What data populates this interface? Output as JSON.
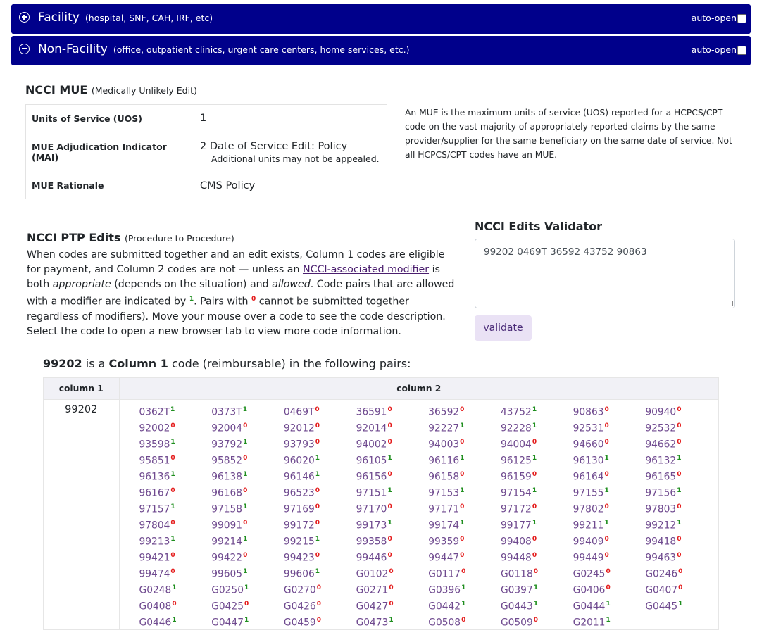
{
  "sections": [
    {
      "label": "Facility",
      "sub": "(hospital, SNF, CAH, IRF, etc)",
      "state": "collapsed",
      "auto": "auto-open"
    },
    {
      "label": "Non-Facility",
      "sub": "(office, outpatient clinics, urgent care centers, home services, etc.)",
      "state": "expanded",
      "auto": "auto-open"
    }
  ],
  "mue": {
    "title": "NCCI MUE",
    "subtitle": "(Medically Unlikely Edit)",
    "rows": [
      {
        "k": "Units of Service (UOS)",
        "v": "1"
      },
      {
        "k": "MUE Adjudication Indicator (MAI)",
        "v": "2 Date of Service Edit: Policy",
        "note": "Additional units may not be appealed."
      },
      {
        "k": "MUE Rationale",
        "v": "CMS Policy"
      }
    ],
    "desc": "An MUE is the maximum units of service (UOS) reported for a HCPCS/CPT code on the vast majority of appropriately reported claims by the same provider/supplier for the same beneficiary on the same date of service. Not all HCPCS/CPT codes have an MUE."
  },
  "ptp": {
    "title": "NCCI PTP Edits",
    "subtitle": "(Procedure to Procedure)",
    "t1": "When codes are submitted together and an edit exists, Column 1 codes are eligible for payment, and Column 2 codes are not — unless an ",
    "link": "NCCI-associated modifier",
    "t2": " is both ",
    "em1": "appropriate",
    "t3": " (depends on the situation) and ",
    "em2": "allowed",
    "t4": ". Code pairs that are allowed with a modifier are indicated by ",
    "s1": "1",
    "t5": ". Pairs with ",
    "s0": "0",
    "t6": " cannot be submitted together regardless of modifiers). Move your mouse over a code to see the code description. Select the code to open a new browser tab to view more code information."
  },
  "validator": {
    "title": "NCCI Edits Validator",
    "value": "99202 0469T 36592 43752 90863",
    "button": "validate"
  },
  "pairs": {
    "code": "99202",
    "mid": " is a ",
    "col": "Column 1",
    "tail": " code (reimbursable) in the following pairs:",
    "col1_header": "column 1",
    "col2_header": "column 2",
    "col1_value": "99202",
    "codes": [
      [
        "0362T",
        "1"
      ],
      [
        "0373T",
        "1"
      ],
      [
        "0469T",
        "0"
      ],
      [
        "36591",
        "0"
      ],
      [
        "36592",
        "0"
      ],
      [
        "43752",
        "1"
      ],
      [
        "90863",
        "0"
      ],
      [
        "90940",
        "0"
      ],
      [
        "92002",
        "0"
      ],
      [
        "92004",
        "0"
      ],
      [
        "92012",
        "0"
      ],
      [
        "92014",
        "0"
      ],
      [
        "92227",
        "1"
      ],
      [
        "92228",
        "1"
      ],
      [
        "92531",
        "0"
      ],
      [
        "92532",
        "0"
      ],
      [
        "93598",
        "1"
      ],
      [
        "93792",
        "1"
      ],
      [
        "93793",
        "0"
      ],
      [
        "94002",
        "0"
      ],
      [
        "94003",
        "0"
      ],
      [
        "94004",
        "0"
      ],
      [
        "94660",
        "0"
      ],
      [
        "94662",
        "0"
      ],
      [
        "95851",
        "0"
      ],
      [
        "95852",
        "0"
      ],
      [
        "96020",
        "1"
      ],
      [
        "96105",
        "1"
      ],
      [
        "96116",
        "1"
      ],
      [
        "96125",
        "1"
      ],
      [
        "96130",
        "1"
      ],
      [
        "96132",
        "1"
      ],
      [
        "96136",
        "1"
      ],
      [
        "96138",
        "1"
      ],
      [
        "96146",
        "1"
      ],
      [
        "96156",
        "0"
      ],
      [
        "96158",
        "0"
      ],
      [
        "96159",
        "0"
      ],
      [
        "96164",
        "0"
      ],
      [
        "96165",
        "0"
      ],
      [
        "96167",
        "0"
      ],
      [
        "96168",
        "0"
      ],
      [
        "96523",
        "0"
      ],
      [
        "97151",
        "1"
      ],
      [
        "97153",
        "1"
      ],
      [
        "97154",
        "1"
      ],
      [
        "97155",
        "1"
      ],
      [
        "97156",
        "1"
      ],
      [
        "97157",
        "1"
      ],
      [
        "97158",
        "1"
      ],
      [
        "97169",
        "0"
      ],
      [
        "97170",
        "0"
      ],
      [
        "97171",
        "0"
      ],
      [
        "97172",
        "0"
      ],
      [
        "97802",
        "0"
      ],
      [
        "97803",
        "0"
      ],
      [
        "97804",
        "0"
      ],
      [
        "99091",
        "0"
      ],
      [
        "99172",
        "0"
      ],
      [
        "99173",
        "1"
      ],
      [
        "99174",
        "1"
      ],
      [
        "99177",
        "1"
      ],
      [
        "99211",
        "1"
      ],
      [
        "99212",
        "1"
      ],
      [
        "99213",
        "1"
      ],
      [
        "99214",
        "1"
      ],
      [
        "99215",
        "1"
      ],
      [
        "99358",
        "0"
      ],
      [
        "99359",
        "0"
      ],
      [
        "99408",
        "0"
      ],
      [
        "99409",
        "0"
      ],
      [
        "99418",
        "0"
      ],
      [
        "99421",
        "0"
      ],
      [
        "99422",
        "0"
      ],
      [
        "99423",
        "0"
      ],
      [
        "99446",
        "0"
      ],
      [
        "99447",
        "0"
      ],
      [
        "99448",
        "0"
      ],
      [
        "99449",
        "0"
      ],
      [
        "99463",
        "0"
      ],
      [
        "99474",
        "0"
      ],
      [
        "99605",
        "1"
      ],
      [
        "99606",
        "1"
      ],
      [
        "G0102",
        "0"
      ],
      [
        "G0117",
        "0"
      ],
      [
        "G0118",
        "0"
      ],
      [
        "G0245",
        "0"
      ],
      [
        "G0246",
        "0"
      ],
      [
        "G0248",
        "1"
      ],
      [
        "G0250",
        "1"
      ],
      [
        "G0270",
        "0"
      ],
      [
        "G0271",
        "0"
      ],
      [
        "G0396",
        "1"
      ],
      [
        "G0397",
        "1"
      ],
      [
        "G0406",
        "0"
      ],
      [
        "G0407",
        "0"
      ],
      [
        "G0408",
        "0"
      ],
      [
        "G0425",
        "0"
      ],
      [
        "G0426",
        "0"
      ],
      [
        "G0427",
        "0"
      ],
      [
        "G0442",
        "1"
      ],
      [
        "G0443",
        "1"
      ],
      [
        "G0444",
        "1"
      ],
      [
        "G0445",
        "1"
      ],
      [
        "G0446",
        "1"
      ],
      [
        "G0447",
        "1"
      ],
      [
        "G0459",
        "0"
      ],
      [
        "G0473",
        "1"
      ],
      [
        "G0508",
        "0"
      ],
      [
        "G0509",
        "0"
      ],
      [
        "G2011",
        "1"
      ]
    ]
  }
}
